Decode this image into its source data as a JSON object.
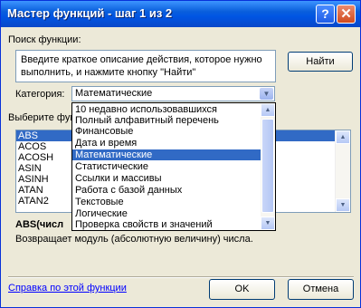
{
  "window": {
    "title": "Мастер функций - шаг 1 из 2"
  },
  "search": {
    "label": "Поиск функции:",
    "text": "Введите краткое описание действия, которое нужно выполнить, и нажмите кнопку \"Найти\"",
    "find_button": "Найти"
  },
  "category": {
    "label": "Категория:",
    "selected": "Математические",
    "options": [
      "10 недавно использовавшихся",
      "Полный алфавитный перечень",
      "Финансовые",
      "Дата и время",
      "Математические",
      "Статистические",
      "Ссылки и массивы",
      "Работа с базой данных",
      "Текстовые",
      "Логические",
      "Проверка свойств и значений"
    ]
  },
  "functions": {
    "label": "Выберите фун",
    "items": [
      "ABS",
      "ACOS",
      "ACOSH",
      "ASIN",
      "ASINH",
      "ATAN",
      "ATAN2"
    ],
    "selected": "ABS"
  },
  "signature": "ABS(числ",
  "description": "Возвращает модуль (абсолютную величину) числа.",
  "help_link": "Справка по этой функции",
  "buttons": {
    "ok": "OK",
    "cancel": "Отмена"
  },
  "colors": {
    "title_bar": "#0054e3",
    "selection": "#316ac5",
    "dialog_bg": "#ece9d8",
    "link": "#0000ff"
  }
}
